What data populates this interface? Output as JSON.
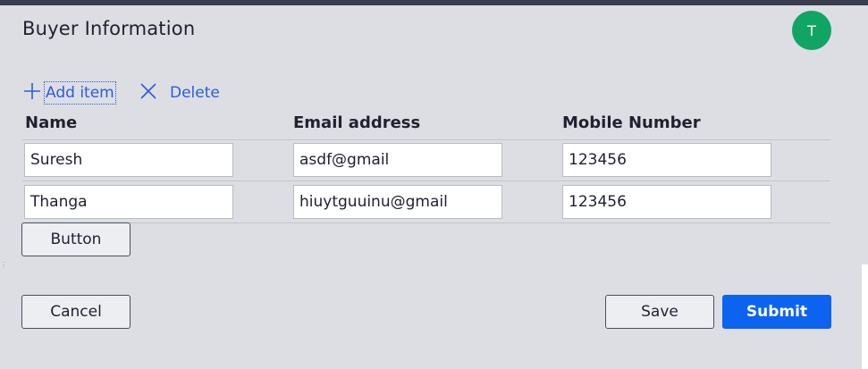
{
  "header": {
    "title": "Buyer Information",
    "avatar_initial": "T"
  },
  "toolbar": {
    "add_label": "Add item",
    "delete_label": "Delete"
  },
  "table": {
    "columns": [
      "Name",
      "Email address",
      "Mobile Number"
    ],
    "rows": [
      {
        "name": "Suresh",
        "email": "asdf@gmail",
        "mobile": "123456"
      },
      {
        "name": "Thanga",
        "email": "hiuytguuinu@gmail",
        "mobile": "123456"
      }
    ]
  },
  "actions": {
    "table_button_label": "Button",
    "cancel_label": "Cancel",
    "save_label": "Save",
    "submit_label": "Submit"
  },
  "colors": {
    "accent": "#0b63f0",
    "link": "#2e5bd9",
    "avatar_bg": "#10a562",
    "panel_bg": "#dddee3"
  },
  "icons": {
    "add": "plus-icon",
    "delete": "close-icon"
  }
}
